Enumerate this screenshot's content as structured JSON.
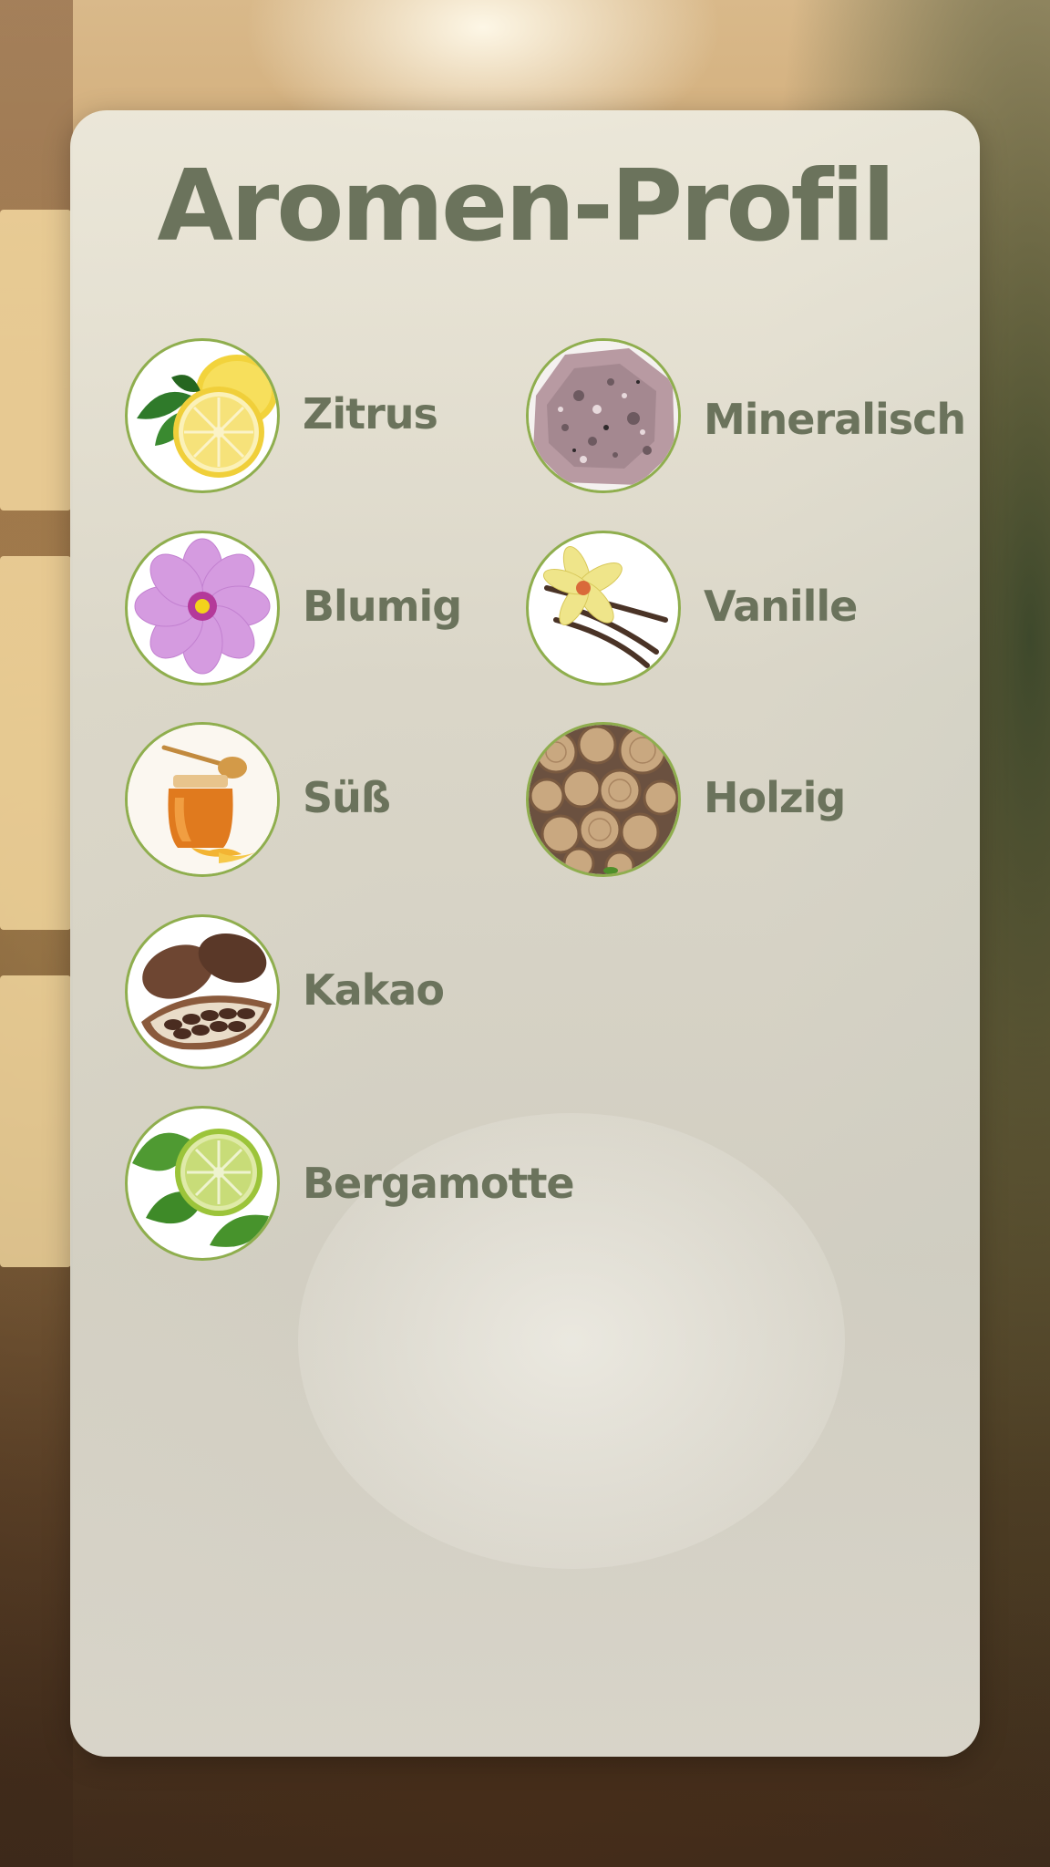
{
  "title": "Aromen-Profil",
  "aromas": [
    {
      "label": "Zitrus",
      "icon": "lemon-icon"
    },
    {
      "label": "Mineralisch",
      "icon": "mineral-rock-icon"
    },
    {
      "label": "Blumig",
      "icon": "flower-icon"
    },
    {
      "label": "Vanille",
      "icon": "vanilla-icon"
    },
    {
      "label": "Süß",
      "icon": "honey-jar-icon"
    },
    {
      "label": "Holzig",
      "icon": "wood-logs-icon"
    },
    {
      "label": "Kakao",
      "icon": "cocoa-pod-icon"
    },
    {
      "label": "Bergamotte",
      "icon": "bergamot-icon"
    }
  ],
  "colors": {
    "text": "#6b735c",
    "ring": "#8fae4e"
  }
}
